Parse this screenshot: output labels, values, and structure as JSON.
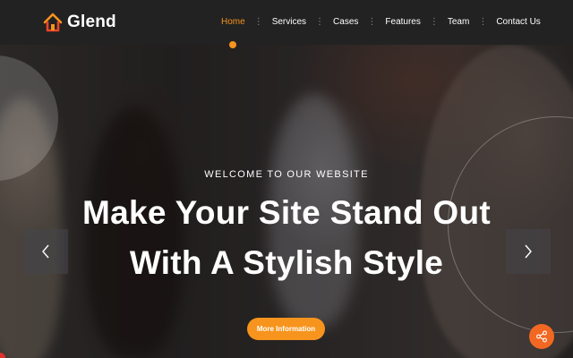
{
  "brand": {
    "name": "Glend",
    "icon": "house-logo-icon",
    "accent": "#f7941d"
  },
  "nav": {
    "items": [
      {
        "label": "Home",
        "active": true
      },
      {
        "label": "Services",
        "active": false
      },
      {
        "label": "Cases",
        "active": false
      },
      {
        "label": "Features",
        "active": false
      },
      {
        "label": "Team",
        "active": false
      },
      {
        "label": "Contact Us",
        "active": false
      }
    ],
    "separator": "⋮"
  },
  "hero": {
    "eyebrow": "WELCOME TO OUR WEBSITE",
    "headline_line1": "Make Your Site Stand Out",
    "headline_line2": "With A Stylish Style",
    "cta_label": "More Information",
    "prev_icon": "chevron-left-icon",
    "next_icon": "chevron-right-icon"
  },
  "floating": {
    "share_icon": "share-icon",
    "share_color": "#f26722"
  }
}
